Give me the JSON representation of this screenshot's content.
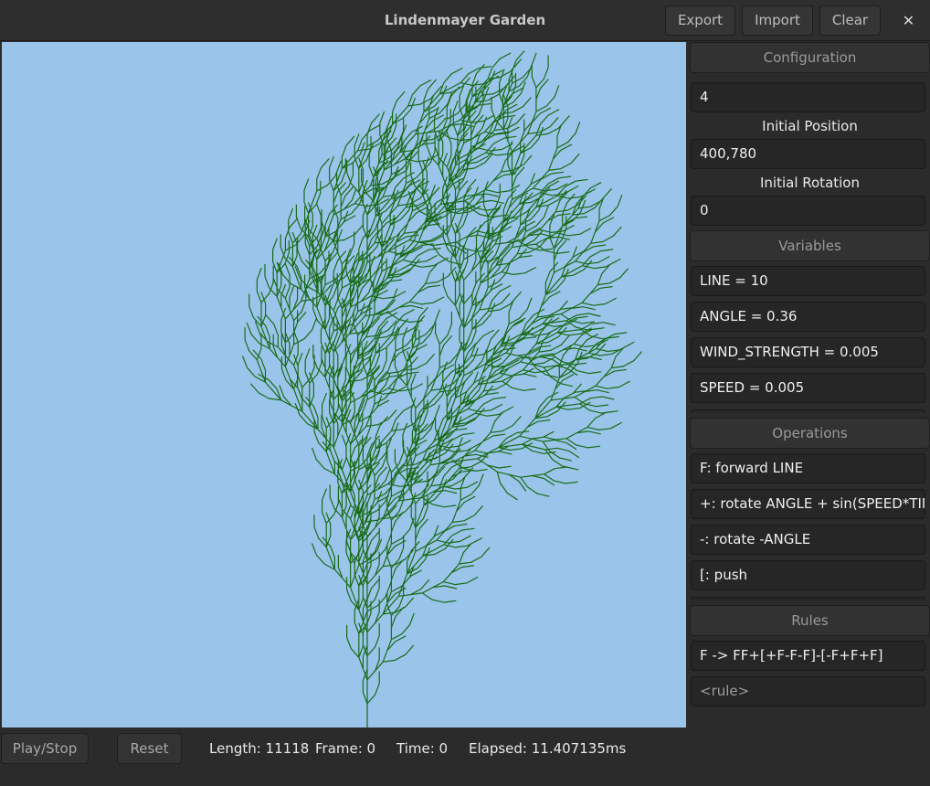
{
  "window": {
    "title": "Lindenmayer Garden",
    "close_glyph": "✕"
  },
  "header_buttons": {
    "export": "Export",
    "import": "Import",
    "clear": "Clear"
  },
  "sidebar": {
    "configuration": {
      "header": "Configuration",
      "iterations": "4",
      "initial_position_label": "Initial Position",
      "initial_position": "400,780",
      "initial_rotation_label": "Initial Rotation",
      "initial_rotation": "0"
    },
    "variables": {
      "header": "Variables",
      "items": [
        "LINE = 10",
        "ANGLE = 0.36",
        "WIND_STRENGTH = 0.005",
        "SPEED = 0.005"
      ]
    },
    "operations": {
      "header": "Operations",
      "items": [
        "F: forward LINE",
        "+: rotate ANGLE + sin(SPEED*TIME*I",
        "-: rotate -ANGLE",
        "[: push"
      ]
    },
    "rules": {
      "header": "Rules",
      "items": [
        "F -> FF+[+F-F-F]-[-F+F+F]"
      ],
      "placeholder": "<rule>"
    }
  },
  "controls": {
    "play_stop": "Play/Stop",
    "reset": "Reset"
  },
  "status": {
    "length": "Length: 11118",
    "frame": "Frame: 0",
    "time": "Time: 0",
    "elapsed": "Elapsed: 11.407135ms"
  },
  "colors": {
    "sky": "#9ac4e9",
    "plant": "#1a6b1a"
  },
  "lsystem": {
    "axiom": "F",
    "rule_from": "F",
    "rule_to": "FF+[+F-F-F]-[-F+F+F]",
    "iterations": 4,
    "line": 10,
    "angle": 0.36,
    "start": [
      400,
      780
    ],
    "rotation": 0
  }
}
